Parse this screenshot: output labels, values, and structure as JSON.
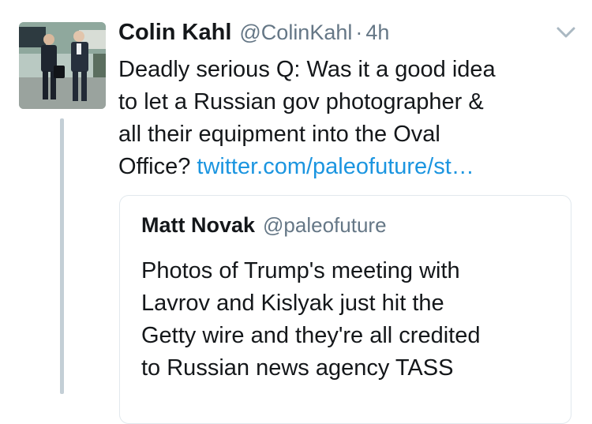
{
  "tweet": {
    "author": {
      "name": "Colin Kahl",
      "handle": "@ColinKahl"
    },
    "separator": "·",
    "timestamp": "4h",
    "text_lines": [
      "Deadly serious Q: Was it a good idea",
      "to let a Russian gov photographer &",
      "all their equipment into the Oval"
    ],
    "last_line_prefix": "Office? ",
    "link_text": "twitter.com/paleofuture/st…",
    "menu_icon": "chevron-down-icon",
    "colors": {
      "text": "#14171a",
      "secondary": "#657786",
      "link": "#1b95e0",
      "thread_line": "#c4cfd6",
      "border": "#e1e8ed"
    }
  },
  "quoted_tweet": {
    "author": {
      "name": "Matt Novak",
      "handle": "@paleofuture"
    },
    "text_lines": [
      "Photos of Trump's meeting with",
      "Lavrov and Kislyak just hit the",
      "Getty wire and they're all credited",
      "to Russian news agency TASS"
    ]
  }
}
